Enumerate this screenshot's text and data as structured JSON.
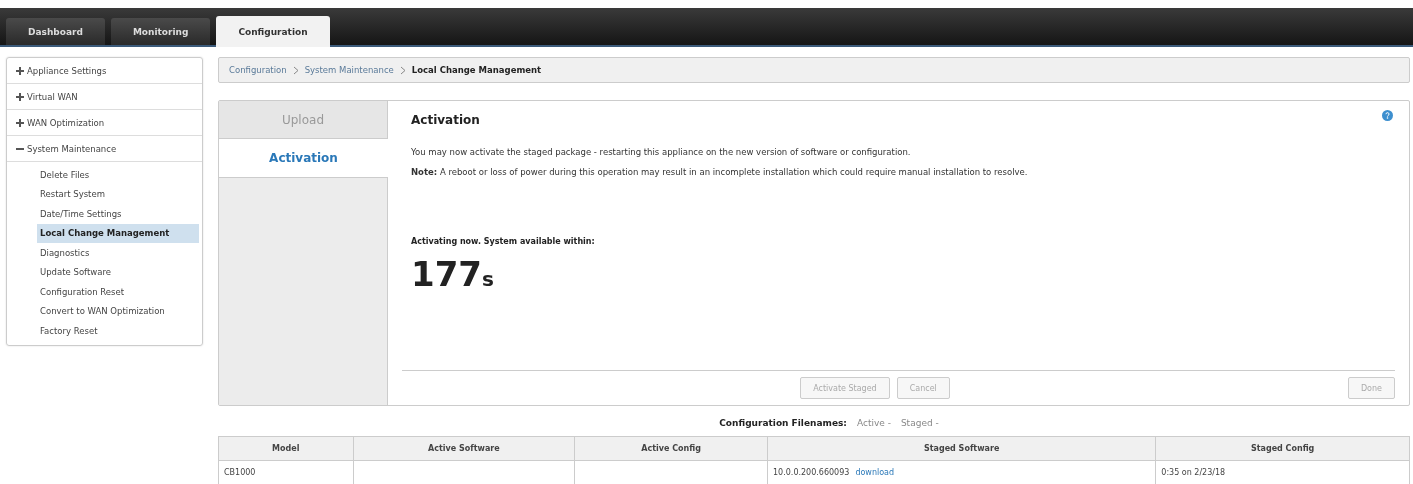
{
  "nav_tabs": [
    {
      "label": "Dashboard",
      "selected": false
    },
    {
      "label": "Monitoring",
      "selected": false
    },
    {
      "label": "Configuration",
      "selected": true
    }
  ],
  "sidebar": {
    "groups": [
      {
        "label": "Appliance Settings",
        "expanded": false
      },
      {
        "label": "Virtual WAN",
        "expanded": false
      },
      {
        "label": "WAN Optimization",
        "expanded": false
      },
      {
        "label": "System Maintenance",
        "expanded": true,
        "children": [
          {
            "label": "Delete Files",
            "selected": false
          },
          {
            "label": "Restart System",
            "selected": false
          },
          {
            "label": "Date/Time Settings",
            "selected": false
          },
          {
            "label": "Local Change Management",
            "selected": true
          },
          {
            "label": "Diagnostics",
            "selected": false
          },
          {
            "label": "Update Software",
            "selected": false
          },
          {
            "label": "Configuration Reset",
            "selected": false
          },
          {
            "label": "Convert to WAN Optimization",
            "selected": false
          },
          {
            "label": "Factory Reset",
            "selected": false
          }
        ]
      }
    ]
  },
  "breadcrumb": [
    "Configuration",
    "System Maintenance",
    "Local Change Management"
  ],
  "panel": {
    "tabs": [
      {
        "label": "Upload",
        "selected": false
      },
      {
        "label": "Activation",
        "selected": true
      }
    ],
    "title": "Activation",
    "message": "You may now activate the staged package - restarting this appliance on the new version of software or configuration.",
    "note": "**Note:** A reboot or loss of power during this operation may result in an incomplete installation which could require manual installation to resolve.",
    "status_label": "Activating now. System available within:",
    "countdown": "177",
    "countdown_unit": "s",
    "buttons": [
      {
        "label": "Activate Staged",
        "disabled": true
      },
      {
        "label": "Cancel",
        "disabled": true
      },
      {
        "label": "Done",
        "disabled": true
      }
    ]
  },
  "filenames": {
    "label": "Configuration Filenames:",
    "active": "Active -",
    "staged": "Staged -"
  },
  "table": {
    "columns": [
      "Model",
      "Active Software",
      "Active Config",
      "Staged Software",
      "Staged Config"
    ],
    "rows": [
      {
        "model": "CB1000",
        "staged_software": "10.0.0.200.660093",
        "staged_software_link": "download",
        "staged_config": "0:35 on 2/23/18"
      }
    ]
  }
}
